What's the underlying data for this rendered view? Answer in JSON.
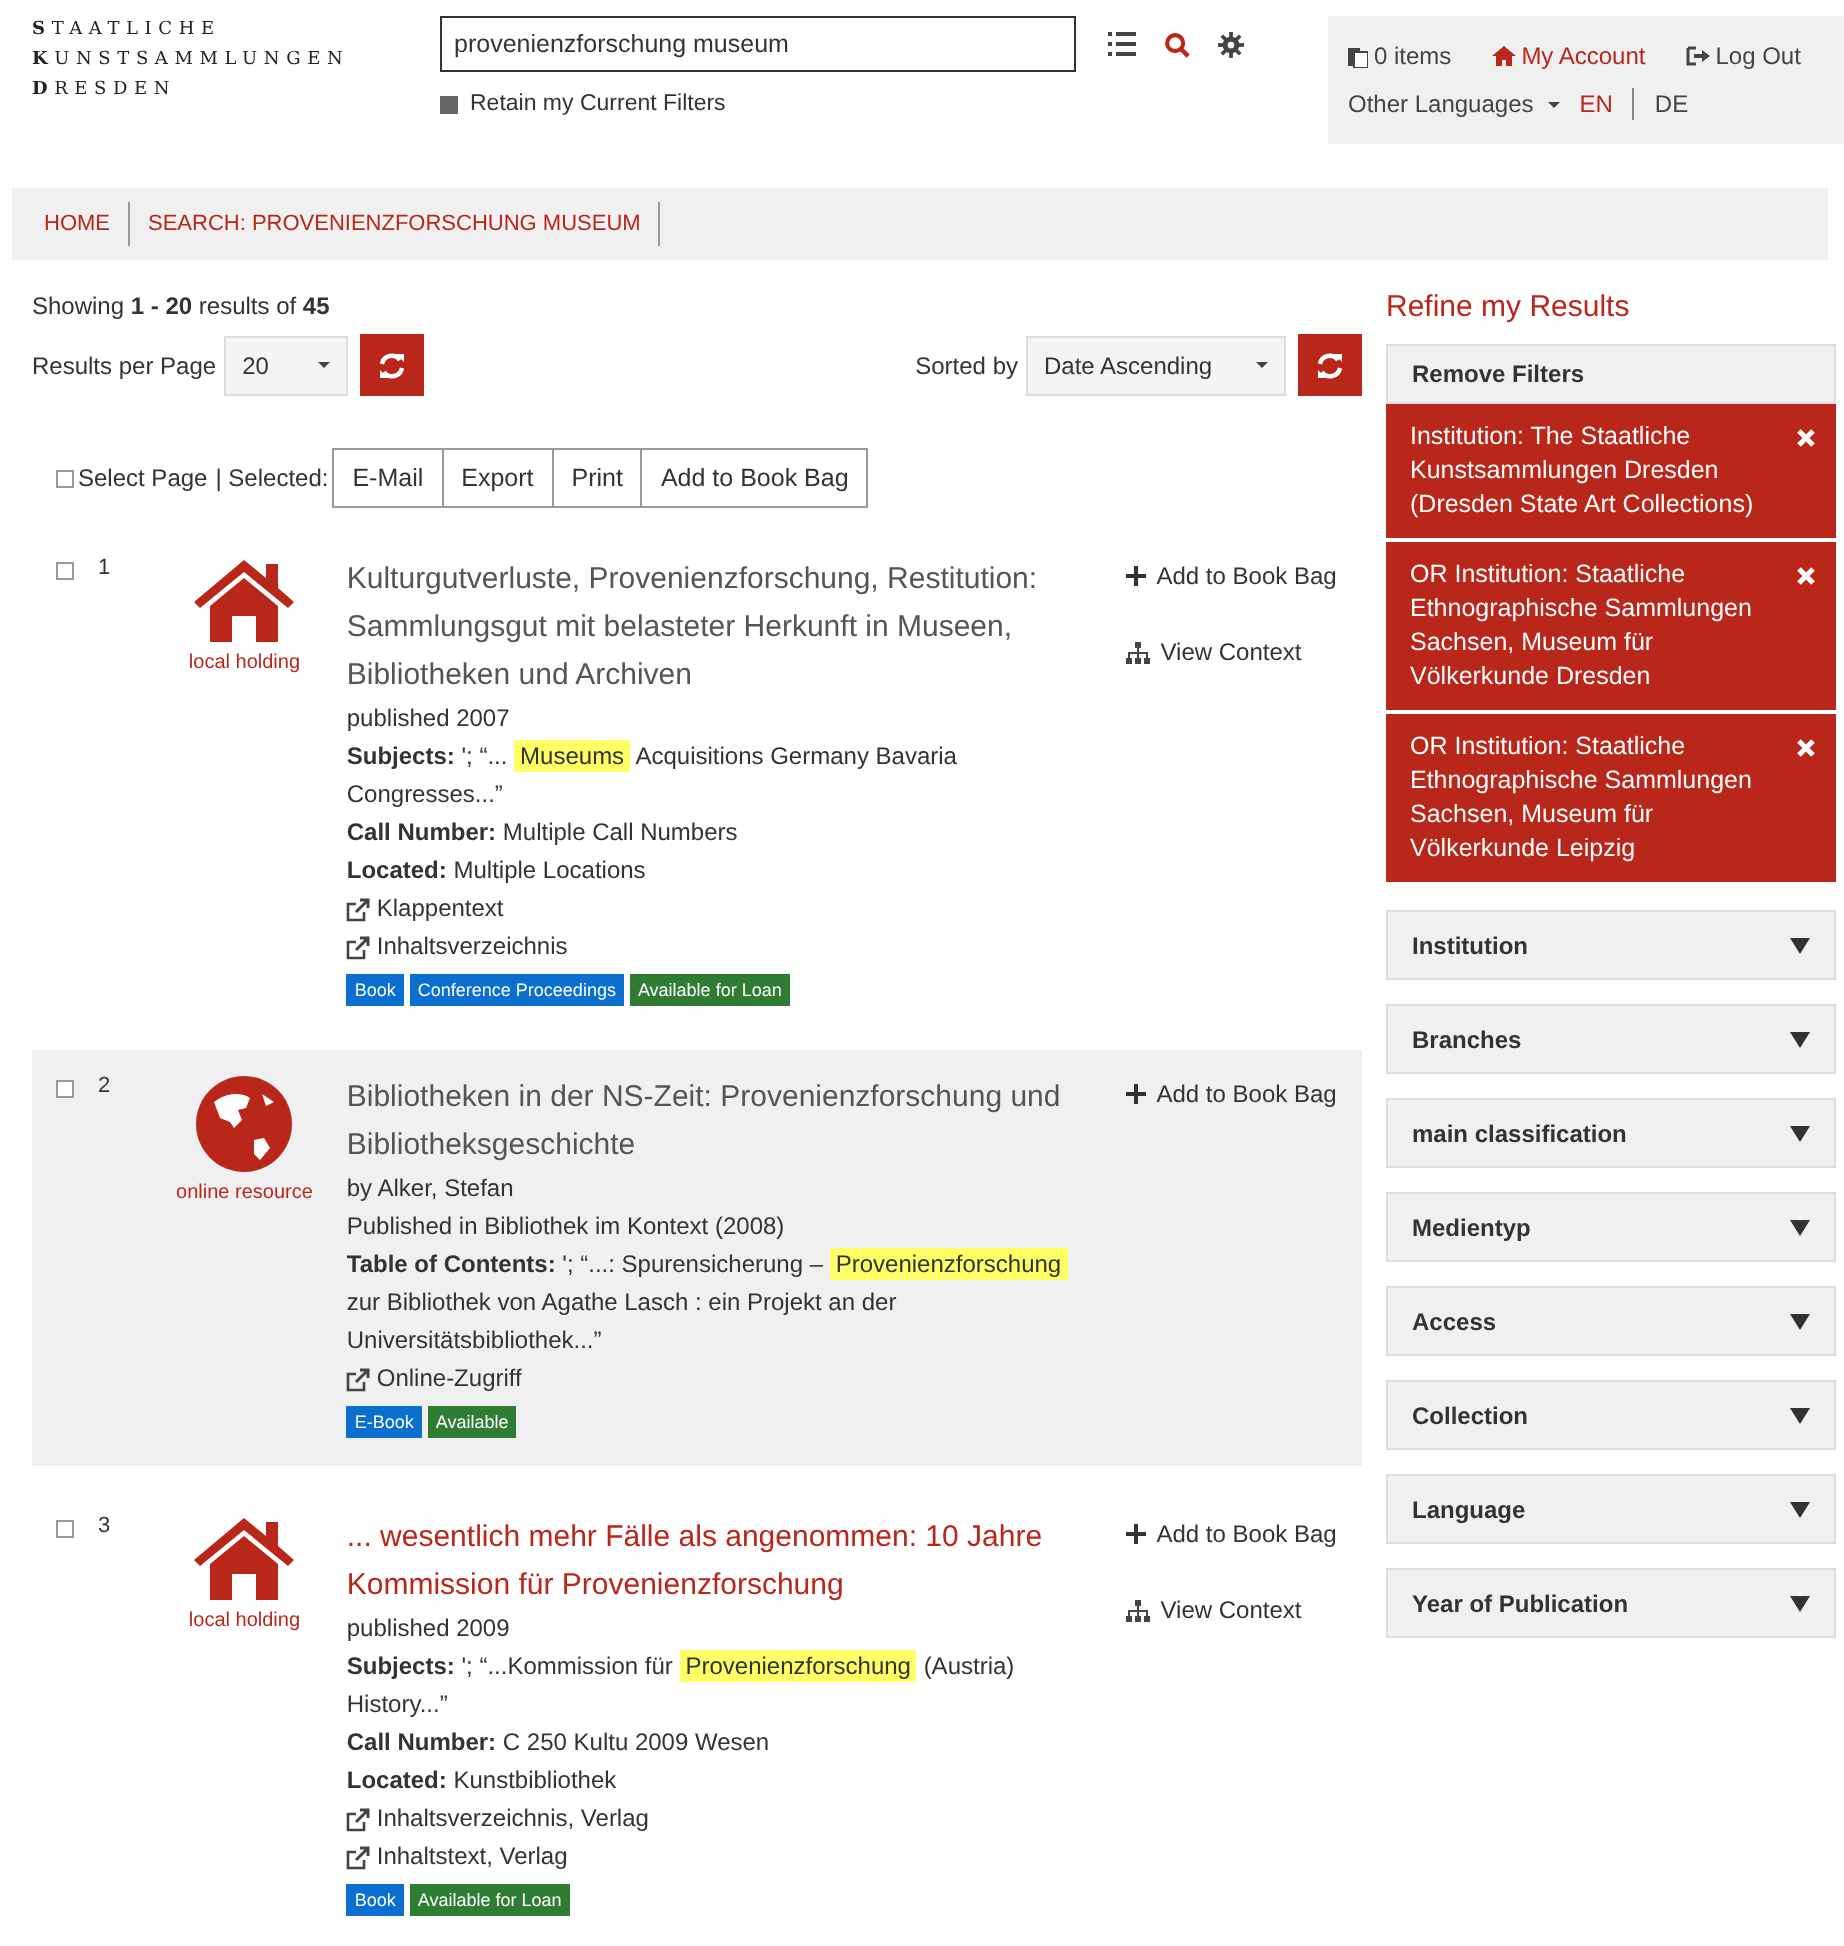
{
  "logo": {
    "lines": [
      "**S**TAATLICHE",
      "**K**UNSTSAMMLUNGEN",
      "**D**RESDEN"
    ]
  },
  "search": {
    "value": "provenienzforschung museum",
    "retain_filters": {
      "label": "Retain my Current Filters",
      "checked": true
    }
  },
  "account": {
    "items": "0 items",
    "my_account": "My Account",
    "log_out": "Log Out",
    "other_languages": "Other Languages",
    "languages": [
      {
        "label": "EN",
        "selected": true
      },
      {
        "label": "DE",
        "selected": false
      }
    ]
  },
  "breadcrumb": [
    "HOME",
    "SEARCH: PROVENIENZFORSCHUNG MUSEUM"
  ],
  "summary": {
    "prefix": "Showing",
    "range": "1 - 20",
    "middle": "results of",
    "total": "45"
  },
  "per_page": {
    "label": "Results per Page",
    "value": "20"
  },
  "sort": {
    "label": "Sorted by",
    "value": "Date Ascending"
  },
  "bulk": {
    "select_page": {
      "label": "Select Page",
      "checked": false
    },
    "selected_label": "| Selected:",
    "buttons": [
      "E-Mail",
      "Export",
      "Print",
      "Add to Book Bag"
    ]
  },
  "results": [
    {
      "number": "1",
      "checked": false,
      "shaded": false,
      "title_hovered": false,
      "format": {
        "kind": "house",
        "label": "local holding"
      },
      "title": "Kulturgutverluste, Provenienzforschung, Restitution: Sammlungsgut mit belasteter Herkunft in Museen, Bibliotheken und Archiven",
      "actions": [
        {
          "kind": "add",
          "label": "Add to Book Bag"
        },
        {
          "kind": "context",
          "label": "View Context"
        }
      ],
      "lines": [
        {
          "kind": "plain",
          "text": "published 2007"
        },
        {
          "kind": "field",
          "label": "Subjects:",
          "parts": [
            {
              "text": "'; “...",
              "highlight": false
            },
            {
              "text": "Museums",
              "highlight": true
            },
            {
              "text": "Acquisitions Germany Bavaria Congresses...”",
              "highlight": false
            }
          ]
        },
        {
          "kind": "field",
          "label": "Call Number:",
          "parts": [
            {
              "text": "Multiple Call Numbers",
              "highlight": false
            }
          ]
        },
        {
          "kind": "field",
          "label": "Located:",
          "parts": [
            {
              "text": "Multiple Locations",
              "highlight": false
            }
          ]
        },
        {
          "kind": "link",
          "text": "Klappentext"
        },
        {
          "kind": "link",
          "text": "Inhaltsverzeichnis"
        }
      ],
      "badges": [
        {
          "text": "Book",
          "color": "#0b6fd0"
        },
        {
          "text": "Conference Proceedings",
          "color": "#0b6fd0"
        },
        {
          "text": "Available for Loan",
          "color": "#2e7d32"
        }
      ]
    },
    {
      "number": "2",
      "checked": false,
      "shaded": true,
      "title_hovered": false,
      "format": {
        "kind": "globe",
        "label": "online resource"
      },
      "title": "Bibliotheken in der NS-Zeit: Provenienzforschung und Bibliotheksgeschichte",
      "actions": [
        {
          "kind": "add",
          "label": "Add to Book Bag"
        }
      ],
      "lines": [
        {
          "kind": "plain",
          "text": "by Alker, Stefan"
        },
        {
          "kind": "plain",
          "text": "Published in Bibliothek im Kontext (2008)"
        },
        {
          "kind": "field",
          "label": "Table of Contents:",
          "parts": [
            {
              "text": "'; “...: Spurensicherung –",
              "highlight": false
            },
            {
              "text": "Provenienzforschung",
              "highlight": true
            },
            {
              "text": "zur Bibliothek von Agathe Lasch : ein Projekt an der Universitätsbibliothek...”",
              "highlight": false
            }
          ]
        },
        {
          "kind": "link",
          "text": "Online-Zugriff"
        }
      ],
      "badges": [
        {
          "text": "E-Book",
          "color": "#0b6fd0"
        },
        {
          "text": "Available",
          "color": "#2e7d32"
        }
      ]
    },
    {
      "number": "3",
      "checked": false,
      "shaded": false,
      "title_hovered": true,
      "format": {
        "kind": "house",
        "label": "local holding"
      },
      "title": "... wesentlich mehr Fälle als angenommen: 10 Jahre Kommission für Provenienzforschung",
      "actions": [
        {
          "kind": "add",
          "label": "Add to Book Bag"
        },
        {
          "kind": "context",
          "label": "View Context"
        }
      ],
      "lines": [
        {
          "kind": "plain",
          "text": "published 2009"
        },
        {
          "kind": "field",
          "label": "Subjects:",
          "parts": [
            {
              "text": "'; “...Kommission für",
              "highlight": false
            },
            {
              "text": "Provenienzforschung",
              "highlight": true
            },
            {
              "text": "(Austria) History...”",
              "highlight": false
            }
          ]
        },
        {
          "kind": "field",
          "label": "Call Number:",
          "parts": [
            {
              "text": "C 250 Kultu 2009 Wesen",
              "highlight": false
            }
          ]
        },
        {
          "kind": "field",
          "label": "Located:",
          "parts": [
            {
              "text": "Kunstbibliothek",
              "highlight": false
            }
          ]
        },
        {
          "kind": "link",
          "text": "Inhaltsverzeichnis, Verlag"
        },
        {
          "kind": "link",
          "text": "Inhaltstext, Verlag"
        }
      ],
      "badges": [
        {
          "text": "Book",
          "color": "#0b6fd0"
        },
        {
          "text": "Available for Loan",
          "color": "#2e7d32"
        }
      ]
    }
  ],
  "sidebar": {
    "title": "Refine my Results",
    "remove_filters": "Remove Filters",
    "filters": [
      "Institution: The Staatliche Kunstsammlungen Dresden (Dresden State Art Collections)",
      "OR Institution: Staatliche Ethnographische Sammlungen Sachsen, Museum für Völkerkunde Dresden",
      "OR Institution: Staatliche Ethnographische Sammlungen Sachsen, Museum für Völkerkunde Leipzig"
    ],
    "facets": [
      {
        "label": "Institution",
        "expanded": false
      },
      {
        "label": "Branches",
        "expanded": false
      },
      {
        "label": "main classification",
        "expanded": false
      },
      {
        "label": "Medientyp",
        "expanded": false
      },
      {
        "label": "Access",
        "expanded": false
      },
      {
        "label": "Collection",
        "expanded": false
      },
      {
        "label": "Language",
        "expanded": false
      },
      {
        "label": "Year of Publication",
        "expanded": false
      }
    ]
  }
}
